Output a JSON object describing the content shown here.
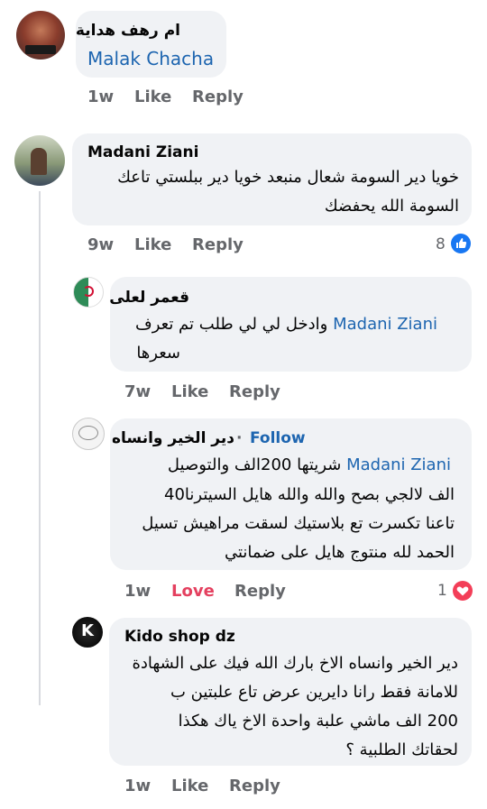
{
  "comment1": {
    "author": "ام رهف هداية",
    "mention": "Malak Chacha",
    "time": "1w",
    "like": "Like",
    "reply": "Reply"
  },
  "comment2": {
    "author": "Madani Ziani",
    "text1": "خويا دير السومة شعال منبعد خويا دير ببلستي تاعك",
    "text2": "السومة الله يحفضك",
    "time": "9w",
    "like": "Like",
    "reply": "Reply",
    "reactions": "8"
  },
  "reply1": {
    "author": "قعمر لعلى",
    "mention": "Madani Ziani",
    "text1": "وادخل لي لي طلب تم تعرف",
    "text2": "سعرها",
    "time": "7w",
    "like": "Like",
    "reply": "Reply"
  },
  "reply2": {
    "author": "دير الخير وانساه",
    "follow": "Follow",
    "mention": "Madani Ziani",
    "text1": "شريتها 200الف والتوصيل",
    "text2": "الف لالجي بصح والله والله هايل السيترنا40",
    "text3": "تاعنا تكسرت تع بلاستيك لسقت مراهيش تسيل",
    "text4": "الحمد لله منتوج هايل على ضمانتي",
    "time": "1w",
    "like": "Love",
    "reply": "Reply",
    "reactions": "1"
  },
  "reply3": {
    "author": "Kido shop dz",
    "text1": "دير الخير وانساه الاخ بارك الله فيك على الشهادة",
    "text2": "للامانة فقط رانا دايرين عرض تاع علبتين ب",
    "text3": "200 الف ماشي علبة واحدة الاخ ياك هكذا",
    "text4": "لحقاتك الطلبية ؟",
    "time": "1w",
    "like": "Like",
    "reply": "Reply"
  },
  "colors": {
    "bubble": "#f0f2f5",
    "mention": "#1d65b0",
    "meta": "#65676b",
    "love": "#e4405f",
    "like_icon": "#1877f2"
  }
}
